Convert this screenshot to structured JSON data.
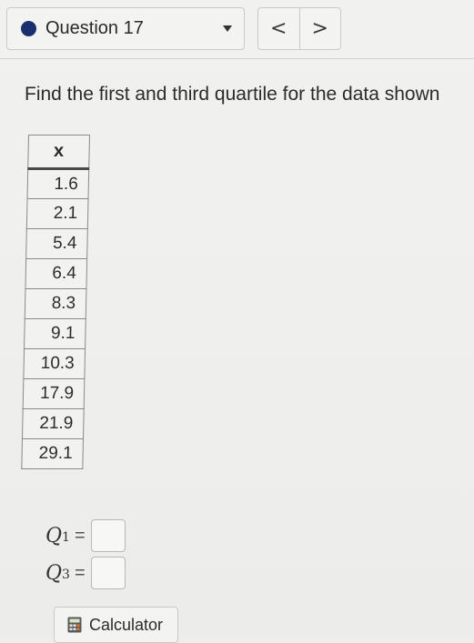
{
  "header": {
    "question_label": "Question 17",
    "status_color": "#1a2f6e",
    "dropdown_icon": "caret-down-icon",
    "prev_label": "<",
    "next_label": ">"
  },
  "main": {
    "prompt": "Find the first and third quartile for the data shown",
    "table": {
      "header": "x",
      "values": [
        "1.6",
        "2.1",
        "5.4",
        "6.4",
        "8.3",
        "9.1",
        "10.3",
        "17.9",
        "21.9",
        "29.1"
      ]
    },
    "answers": [
      {
        "symbol": "Q",
        "subscript": "1",
        "equals": "=",
        "value": ""
      },
      {
        "symbol": "Q",
        "subscript": "3",
        "equals": "=",
        "value": ""
      }
    ],
    "calculator_label": "Calculator",
    "calculator_icon": "calculator-icon"
  }
}
